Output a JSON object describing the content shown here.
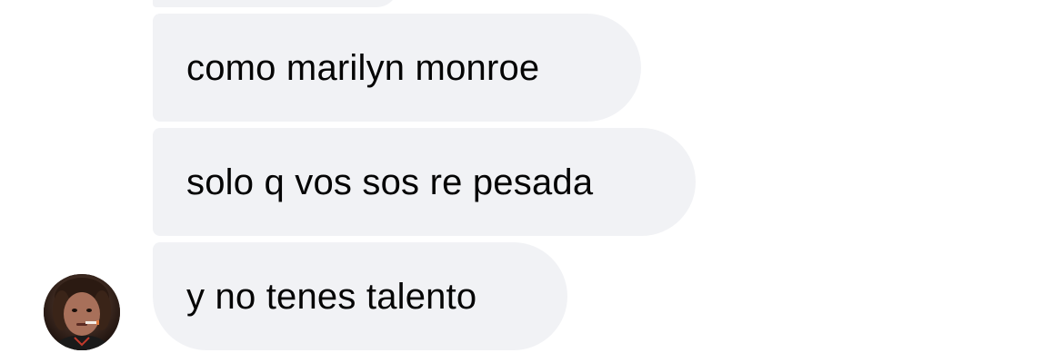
{
  "messages": [
    {
      "text": "como marilyn monroe"
    },
    {
      "text": "solo q vos sos re pesada"
    },
    {
      "text": "y no tenes talento"
    }
  ],
  "colors": {
    "bubble_background": "#f1f2f5",
    "text": "#050505",
    "background": "#ffffff"
  },
  "sender": {
    "avatar_icon": "profile-photo"
  }
}
